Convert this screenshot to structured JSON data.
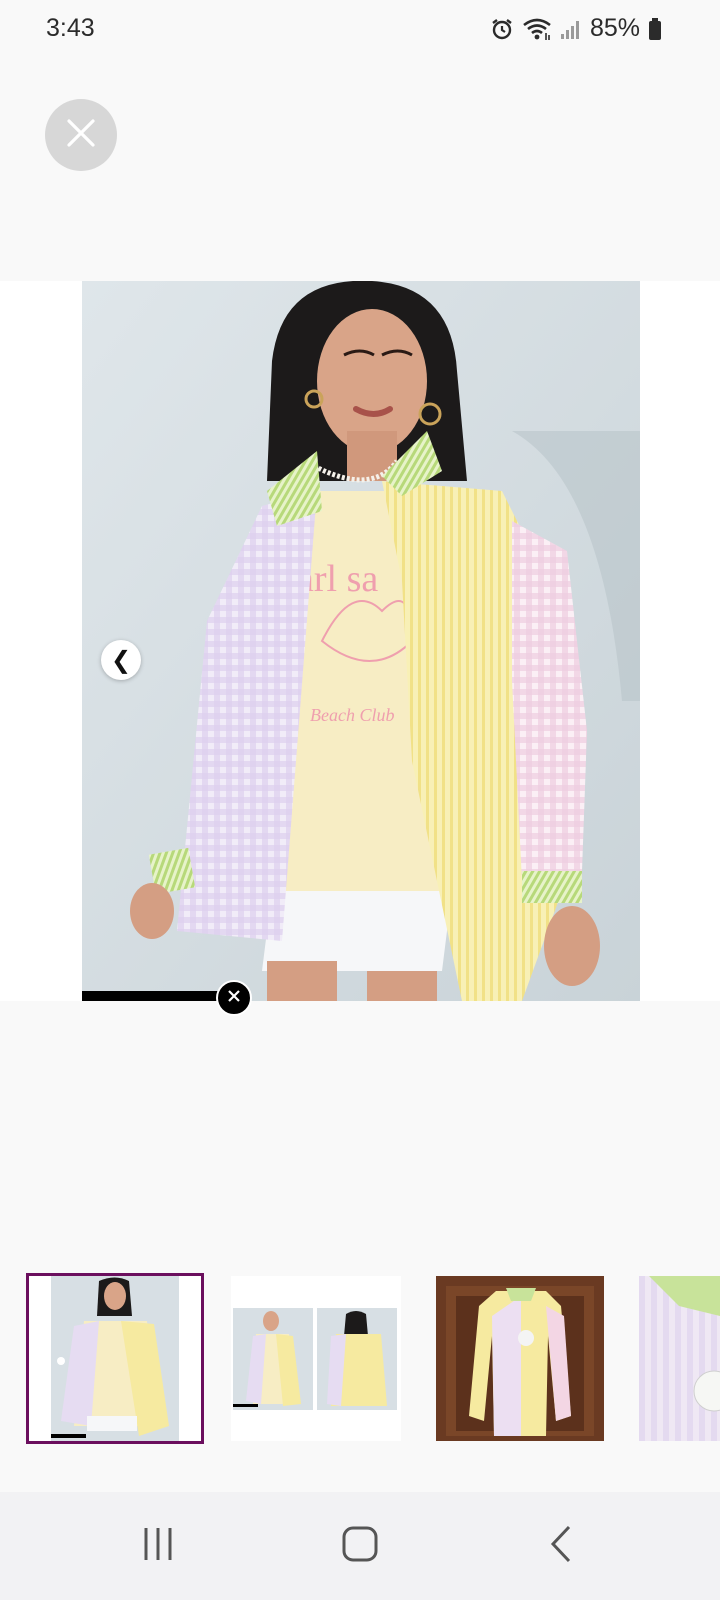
{
  "status_bar": {
    "time": "3:43",
    "battery": "85%",
    "icons": [
      "alarm-icon",
      "wifi-icon",
      "signal-icon",
      "battery-icon"
    ]
  },
  "viewer": {
    "close_icon": "close-icon",
    "prev_icon": "chevron-left-icon",
    "prev_glyph": "❮",
    "main_image": "woman wearing oversized pastel patchwork shirt over t-shirt and white shorts",
    "tee_print_line1": "arl sa",
    "tee_print_line2": "Beach Club"
  },
  "thumbnails": [
    {
      "name": "thumbnail-1",
      "selected": true
    },
    {
      "name": "thumbnail-2",
      "selected": false
    },
    {
      "name": "thumbnail-3",
      "selected": false
    },
    {
      "name": "thumbnail-4",
      "selected": false
    }
  ],
  "nav_bar": {
    "icons": [
      "recent-apps-icon",
      "home-icon",
      "back-icon"
    ]
  },
  "colors": {
    "selected_outline": "#6b0f5e",
    "shirt_yellow": "#f6eaa0",
    "shirt_lilac": "#e6dcf2",
    "shirt_pink": "#f3d6e4",
    "collar_green": "#c8e39a"
  }
}
